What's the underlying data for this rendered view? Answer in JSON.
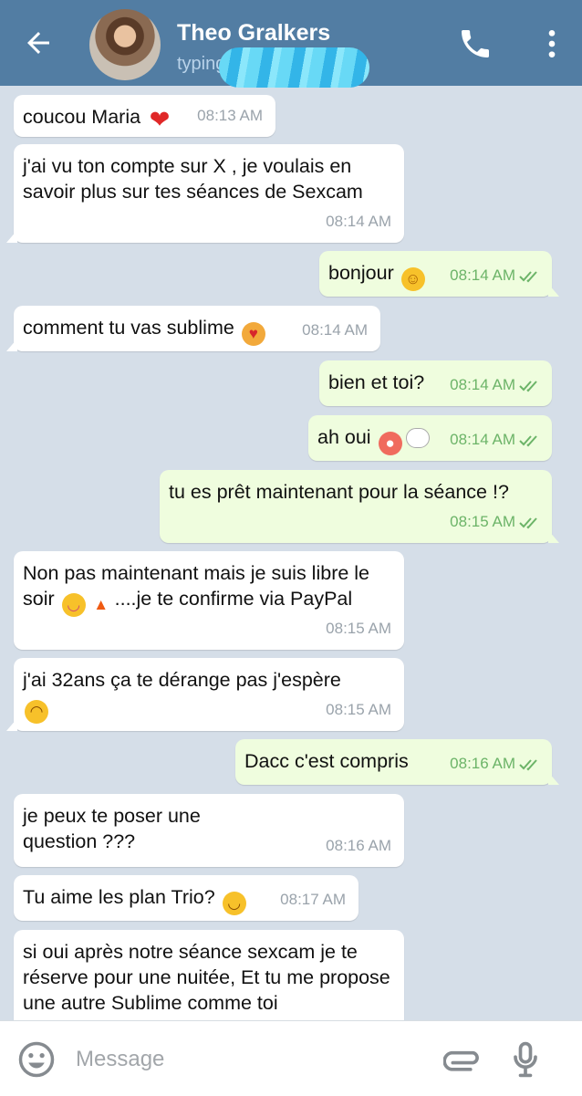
{
  "header": {
    "contact_name": "Theo Gralkers",
    "status": "typing"
  },
  "icons": {
    "back": "arrow-left-icon",
    "phone": "phone-icon",
    "more": "more-vertical-icon",
    "emoji": "emoji-icon",
    "attach": "paperclip-icon",
    "mic": "microphone-icon"
  },
  "composer": {
    "placeholder": "Message"
  },
  "messages": [
    {
      "dir": "in",
      "text": "coucou Maria",
      "emoji": "heart",
      "time": "08:13 AM"
    },
    {
      "dir": "in",
      "text": "j'ai vu ton compte sur X , je voulais en savoir plus sur tes séances de Sexcam",
      "time": "08:14 AM"
    },
    {
      "dir": "out",
      "text": "bonjour",
      "emoji": "smile",
      "time": "08:14 AM",
      "read": true
    },
    {
      "dir": "in",
      "text": "comment tu vas sublime",
      "emoji": "heart-eyes-cat",
      "time": "08:14 AM"
    },
    {
      "dir": "out",
      "text": "bien et toi?",
      "time": "08:14 AM",
      "read": true
    },
    {
      "dir": "out",
      "text": "ah oui",
      "emoji": "flushed thought-bubble",
      "time": "08:14 AM",
      "read": true
    },
    {
      "dir": "out",
      "text": "tu es prêt maintenant pour la séance !?",
      "time": "08:15 AM",
      "read": true
    },
    {
      "dir": "in",
      "text": "Non pas maintenant mais je suis libre le soir",
      "text2": "....je te confirme via PayPal",
      "emoji": "yum fire",
      "time": "08:15 AM"
    },
    {
      "dir": "in",
      "text": "j'ai 32ans ça te dérange pas j'espère",
      "emoji": "laugh",
      "time": "08:15 AM"
    },
    {
      "dir": "out",
      "text": "Dacc c'est compris",
      "time": "08:16 AM",
      "read": true
    },
    {
      "dir": "in",
      "text": "je peux te poser une question ???",
      "time": "08:16 AM"
    },
    {
      "dir": "in",
      "text": "Tu aime les plan Trio?",
      "emoji": "slight-smile",
      "time": "08:17 AM"
    },
    {
      "dir": "in",
      "text": "si oui après notre séance sexcam je te réserve pour une nuitée, Et tu me propose une autre Sublime comme toi"
    }
  ],
  "colors": {
    "header": "#527da3",
    "chat_bg": "#d5dee8",
    "outgoing": "#effdde",
    "check": "#6cb468"
  }
}
